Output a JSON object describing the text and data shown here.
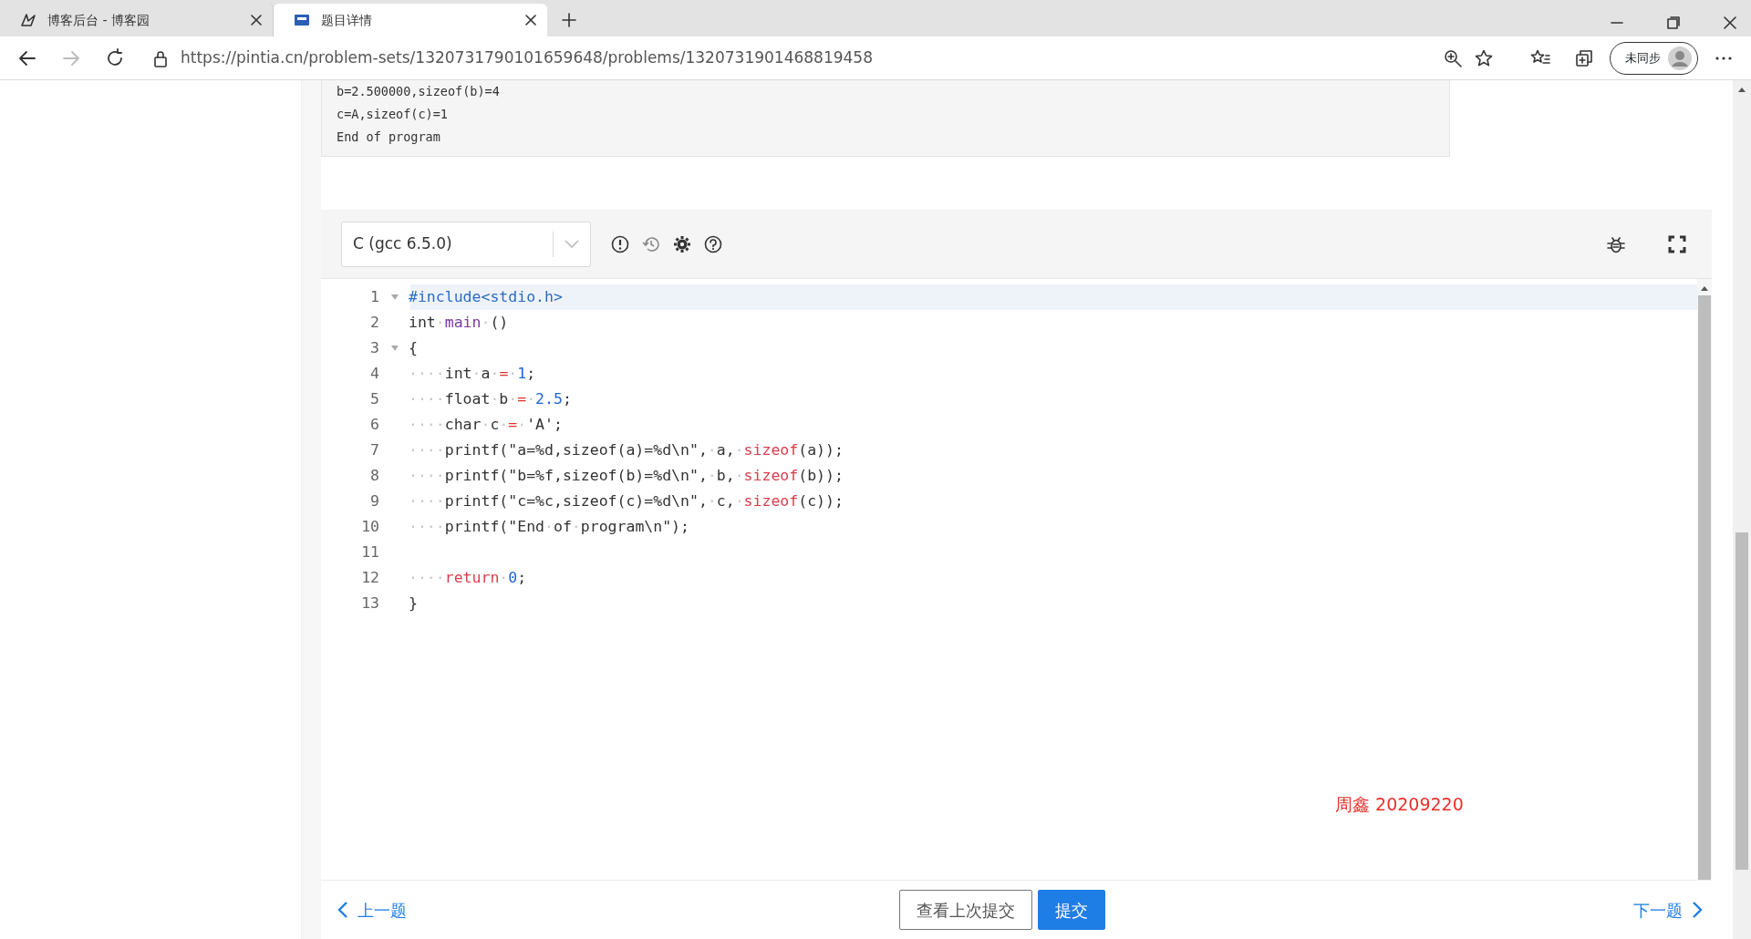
{
  "browser": {
    "tabs": [
      {
        "title": "博客后台 - 博客园",
        "selected": false
      },
      {
        "title": "题目详情",
        "selected": true
      }
    ],
    "nav_buttons": [
      {
        "kind": "back",
        "disabled": false
      },
      {
        "kind": "forward",
        "disabled": true
      },
      {
        "kind": "refresh",
        "disabled": false
      }
    ],
    "url": "https://pintia.cn/problem-sets/1320731790101659648/problems/1320731901468819458",
    "profile": {
      "label": "未同步"
    }
  },
  "output": [
    "b=2.500000,sizeof(b)=4",
    "c=A,sizeof(c)=1",
    "End of program"
  ],
  "editor": {
    "language": "C (gcc 6.5.0)",
    "lines": [
      {
        "number": "1",
        "fold": true,
        "active": true,
        "tokens": [
          {
            "kind": "pre",
            "text": "#include<stdio.h>"
          }
        ]
      },
      {
        "number": "2",
        "fold": false,
        "active": false,
        "tokens": [
          {
            "kind": "plain",
            "text": "int"
          },
          {
            "kind": "ws",
            "text": "·"
          },
          {
            "kind": "ident",
            "text": "main"
          },
          {
            "kind": "ws",
            "text": "·"
          },
          {
            "kind": "plain",
            "text": "()"
          }
        ]
      },
      {
        "number": "3",
        "fold": true,
        "active": false,
        "tokens": [
          {
            "kind": "plain",
            "text": "{"
          }
        ]
      },
      {
        "number": "4",
        "fold": false,
        "active": false,
        "tokens": [
          {
            "kind": "ws",
            "text": "····"
          },
          {
            "kind": "plain",
            "text": "int"
          },
          {
            "kind": "ws",
            "text": "·"
          },
          {
            "kind": "plain",
            "text": "a"
          },
          {
            "kind": "ws",
            "text": "·"
          },
          {
            "kind": "op",
            "text": "="
          },
          {
            "kind": "ws",
            "text": "·"
          },
          {
            "kind": "num",
            "text": "1"
          },
          {
            "kind": "plain",
            "text": ";"
          }
        ]
      },
      {
        "number": "5",
        "fold": false,
        "active": false,
        "tokens": [
          {
            "kind": "ws",
            "text": "····"
          },
          {
            "kind": "plain",
            "text": "float"
          },
          {
            "kind": "ws",
            "text": "·"
          },
          {
            "kind": "plain",
            "text": "b"
          },
          {
            "kind": "ws",
            "text": "·"
          },
          {
            "kind": "op",
            "text": "="
          },
          {
            "kind": "ws",
            "text": "·"
          },
          {
            "kind": "num",
            "text": "2.5"
          },
          {
            "kind": "plain",
            "text": ";"
          }
        ]
      },
      {
        "number": "6",
        "fold": false,
        "active": false,
        "tokens": [
          {
            "kind": "ws",
            "text": "····"
          },
          {
            "kind": "plain",
            "text": "char"
          },
          {
            "kind": "ws",
            "text": "·"
          },
          {
            "kind": "plain",
            "text": "c"
          },
          {
            "kind": "ws",
            "text": "·"
          },
          {
            "kind": "op",
            "text": "="
          },
          {
            "kind": "ws",
            "text": "·"
          },
          {
            "kind": "plain",
            "text": "'A';"
          }
        ]
      },
      {
        "number": "7",
        "fold": false,
        "active": false,
        "tokens": [
          {
            "kind": "ws",
            "text": "····"
          },
          {
            "kind": "plain",
            "text": "printf(\"a=%d,sizeof(a)=%d\\n\","
          },
          {
            "kind": "ws",
            "text": "·"
          },
          {
            "kind": "plain",
            "text": "a,"
          },
          {
            "kind": "ws",
            "text": "·"
          },
          {
            "kind": "kw",
            "text": "sizeof"
          },
          {
            "kind": "plain",
            "text": "(a));"
          }
        ]
      },
      {
        "number": "8",
        "fold": false,
        "active": false,
        "tokens": [
          {
            "kind": "ws",
            "text": "····"
          },
          {
            "kind": "plain",
            "text": "printf(\"b=%f,sizeof(b)=%d\\n\","
          },
          {
            "kind": "ws",
            "text": "·"
          },
          {
            "kind": "plain",
            "text": "b,"
          },
          {
            "kind": "ws",
            "text": "·"
          },
          {
            "kind": "kw",
            "text": "sizeof"
          },
          {
            "kind": "plain",
            "text": "(b));"
          }
        ]
      },
      {
        "number": "9",
        "fold": false,
        "active": false,
        "tokens": [
          {
            "kind": "ws",
            "text": "····"
          },
          {
            "kind": "plain",
            "text": "printf(\"c=%c,sizeof(c)=%d\\n\","
          },
          {
            "kind": "ws",
            "text": "·"
          },
          {
            "kind": "plain",
            "text": "c,"
          },
          {
            "kind": "ws",
            "text": "·"
          },
          {
            "kind": "kw",
            "text": "sizeof"
          },
          {
            "kind": "plain",
            "text": "(c));"
          }
        ]
      },
      {
        "number": "10",
        "fold": false,
        "active": false,
        "tokens": [
          {
            "kind": "ws",
            "text": "····"
          },
          {
            "kind": "plain",
            "text": "printf(\"End"
          },
          {
            "kind": "ws",
            "text": "·"
          },
          {
            "kind": "plain",
            "text": "of"
          },
          {
            "kind": "ws",
            "text": "·"
          },
          {
            "kind": "plain",
            "text": "program\\n\");"
          }
        ]
      },
      {
        "number": "11",
        "fold": false,
        "active": false
      },
      {
        "number": "12",
        "fold": false,
        "active": false,
        "tokens": [
          {
            "kind": "ws",
            "text": "····"
          },
          {
            "kind": "kw",
            "text": "return"
          },
          {
            "kind": "ws",
            "text": "·"
          },
          {
            "kind": "num",
            "text": "0"
          },
          {
            "kind": "plain",
            "text": ";"
          }
        ]
      },
      {
        "number": "13",
        "fold": false,
        "active": false,
        "tokens": [
          {
            "kind": "plain",
            "text": "}"
          }
        ]
      }
    ]
  },
  "annotation": "周鑫 20209220",
  "footer": {
    "prev": "上一题",
    "next": "下一题",
    "buttons": [
      {
        "label": "查看上次提交",
        "kind": "outline"
      },
      {
        "label": "提交",
        "kind": "primary"
      }
    ]
  }
}
